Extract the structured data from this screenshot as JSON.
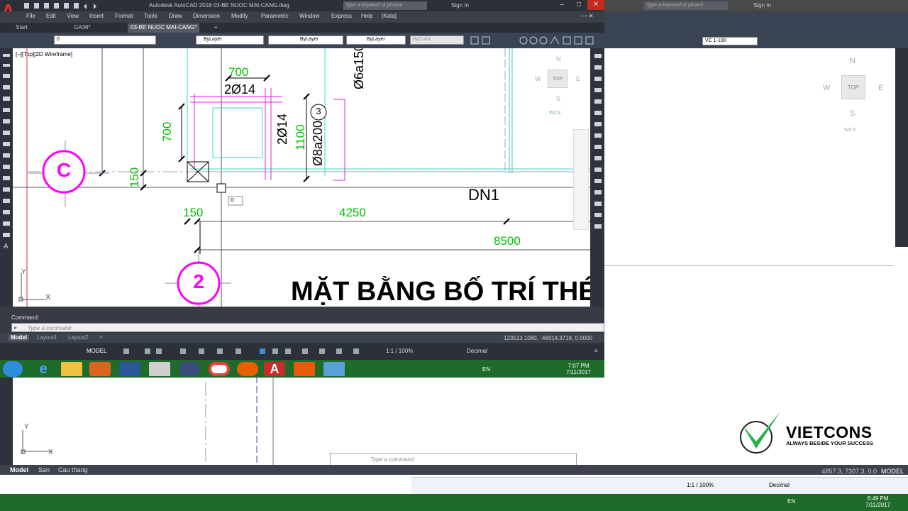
{
  "window": {
    "app_letter": "A",
    "title": "Autodesk AutoCAD 2018   03-BE NUOC MAI-CANG.dwg",
    "search_placeholder": "Type a keyword or phrase",
    "sign_in": "Sign In",
    "minimize": "–",
    "maximize": "□",
    "close": "✕"
  },
  "menu": [
    "File",
    "Edit",
    "View",
    "Insert",
    "Format",
    "Tools",
    "Draw",
    "Dimension",
    "Modify",
    "Parametric",
    "Window",
    "Express",
    "Help",
    "[Kata]"
  ],
  "doc_tabs": [
    {
      "label": "Start",
      "active": false
    },
    {
      "label": "GA36*",
      "active": false
    },
    {
      "label": "03-BE NUOC MAI-CANG*",
      "active": true
    }
  ],
  "ribbon": {
    "layer": "0",
    "color": "ByLayer",
    "linetype": "ByLayer",
    "lineweight": "ByLayer",
    "plotstyle": "ByColor",
    "viewport_scale": "VC 1-100"
  },
  "viewport": {
    "label": "[–][Top][2D Wireframe]",
    "cube": {
      "n": "N",
      "s": "S",
      "e": "E",
      "w": "W",
      "top": "TOP",
      "wcs": "WCS"
    }
  },
  "drawing": {
    "dims": {
      "d700a": "700",
      "d2014a": "2Ø14",
      "d700b": "700",
      "d2014b": "2Ø14",
      "d1100": "1100",
      "d6a150": "Ø6a150",
      "d8a200": "Ø8a200",
      "d150a": "150",
      "d150b": "150",
      "d4250": "4250",
      "d8500": "8500"
    },
    "grid_c": "C",
    "grid_2": "2",
    "mark_3": "3",
    "dn1": "DN1",
    "title": "MẶT BẰNG BỐ TRÍ THÉP",
    "cursor_label": "D"
  },
  "command": {
    "history": "Command:",
    "placeholder": "Type a command"
  },
  "layout_tabs": [
    "Model",
    "Layout1",
    "Layout2"
  ],
  "layout_tabs_bg": [
    "Model",
    "San",
    "Cau thang"
  ],
  "coords": "123513.1080, -46914.3718, 0.0000",
  "coords_bg": "4857.3, 7307.3, 0.0",
  "status": {
    "model": "MODEL",
    "scale": "1:1 / 100%",
    "units": "Decimal"
  },
  "taskbar": {
    "lang": "EN",
    "time": "7:07 PM",
    "date": "7/11/2017",
    "time_bg": "6:49 PM",
    "date_bg": "7/11/2017"
  },
  "logo": {
    "brand": "VIETCONS",
    "tagline": "ALWAYS BESIDE YOUR SUCCESS"
  },
  "colors": {
    "magenta": "#ff00ff",
    "green": "#00c000",
    "cyan": "#00e0e0",
    "autocad_red": "#e03131",
    "taskbar": "#1e6b2a"
  }
}
